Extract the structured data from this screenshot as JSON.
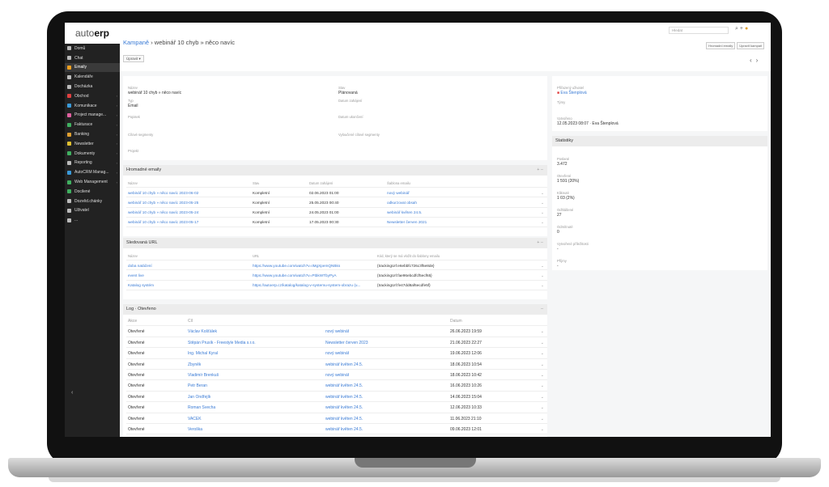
{
  "app": {
    "logo_prefix": "auto",
    "logo_suffix": "erp"
  },
  "sidebar": {
    "items": [
      {
        "label": "Domů",
        "color": "#bbbbbb",
        "icon": "home-icon"
      },
      {
        "label": "Chat",
        "color": "#bbbbbb",
        "icon": "chat-icon"
      },
      {
        "label": "Emaily",
        "color": "#f0a020",
        "icon": "mail-icon",
        "active": true
      },
      {
        "label": "Kalendáře",
        "color": "#bbbbbb",
        "icon": "calendar-icon"
      },
      {
        "label": "Docházka",
        "color": "#bbbbbb",
        "icon": "attendance-icon"
      },
      {
        "label": "Obchod",
        "color": "#e04040",
        "icon": "shop-icon",
        "chev": "›"
      },
      {
        "label": "Komunikace",
        "color": "#3a9ad9",
        "icon": "communication-icon",
        "chev": "›"
      },
      {
        "label": "Project manage...",
        "color": "#e060a0",
        "icon": "project-icon",
        "chev": "›"
      },
      {
        "label": "Fakturace",
        "color": "#40b060",
        "icon": "invoice-icon",
        "chev": "›"
      },
      {
        "label": "Banking",
        "color": "#e0a030",
        "icon": "bank-icon",
        "chev": "›"
      },
      {
        "label": "Newsletter",
        "color": "#e0c030",
        "icon": "newsletter-icon",
        "chev": "›"
      },
      {
        "label": "Dokumenty",
        "color": "#40b060",
        "icon": "documents-icon",
        "chev": "›"
      },
      {
        "label": "Reporting",
        "color": "#bbbbbb",
        "icon": "reporting-icon",
        "chev": "›"
      },
      {
        "label": "AutoCRM Manag...",
        "color": "#3a9ad9",
        "icon": "crm-icon",
        "chev": "›"
      },
      {
        "label": "Web Management",
        "color": "#40b060",
        "icon": "web-icon",
        "chev": "›"
      },
      {
        "label": "Docilené",
        "color": "#40b060",
        "icon": "target-icon"
      },
      {
        "label": "Dozvěd.chánky",
        "color": "#bbbbbb",
        "icon": "notes-icon"
      },
      {
        "label": "Uživatel",
        "color": "#bbbbbb",
        "icon": "user-icon"
      },
      {
        "label": "...",
        "color": "#bbbbbb",
        "icon": "more-icon"
      }
    ],
    "collapse": "‹"
  },
  "topbar": {
    "search_placeholder": "Hledat",
    "breadcrumb_root": "Kampaně",
    "breadcrumb_sep": "›",
    "breadcrumb_current": "webinář 10 chyb » něco navíc",
    "actions_label": "Úpravit",
    "btn1": "Hromadní emaily",
    "btn2": "Upravit kampaň",
    "prev": "‹",
    "next": "›"
  },
  "details": {
    "name_label": "Název",
    "name_value": "webinář 10 chyb » něco navíc",
    "type_label": "Typ",
    "type_value": "Email",
    "desc_label": "Popisek",
    "target_label": "Cílové segmenty",
    "product_label": "Projekt",
    "status_label": "Stav",
    "status_value": "Plánovaná",
    "start_label": "Datum zahájení",
    "end_label": "Datum ukončení",
    "excluded_label": "Vyloučené cílové segmenty"
  },
  "meta": {
    "assigned_label": "Přiřazený uživatel",
    "assigned_value": "Eva Štenplová",
    "teams_label": "Týmy",
    "created_label": "Vytvořeno",
    "created_value": "12.05.2023 08:07 · Eva Štenplová"
  },
  "stats": {
    "title": "Statistiky",
    "items": [
      {
        "label": "Poslané",
        "value": "3.472"
      },
      {
        "label": "Otevřené",
        "value": "1 591 (20%)"
      },
      {
        "label": "Kliknuté",
        "value": "1 03 (2%)"
      },
      {
        "label": "Odhlášené",
        "value": "27"
      },
      {
        "label": "Odmítnuté",
        "value": "0"
      },
      {
        "label": "Vytvořené příležitosti",
        "value": "-"
      },
      {
        "label": "Příjmy",
        "value": "-"
      }
    ]
  },
  "mass_emails": {
    "title": "Hromadné emaily",
    "tools": "+ –",
    "headers": [
      "Název",
      "Stav",
      "Datum zahájení",
      "Šablona emailu"
    ],
    "rows": [
      [
        "webinář 10 chyb » něco navíc 2023-06-02",
        "Kompletní",
        "02.06.2023 01:00",
        "nový webinář"
      ],
      [
        "webinář 10 chyb » něco navíc 2023-05-25",
        "Kompletní",
        "25.05.2023 00:40",
        "odkurzovat obsah"
      ],
      [
        "webinář 10 chyb » něco navíc 2023-05-24",
        "Kompletní",
        "24.05.2023 01:00",
        "webinář květen 24.5."
      ],
      [
        "webinář 10 chyb » něco navíc 2023-05-17",
        "Kompletní",
        "17.05.2023 00:30",
        "Newsletter červen 2021"
      ]
    ]
  },
  "tracked_urls": {
    "title": "Sledovaná URL",
    "tools": "+ –",
    "headers": [
      "Název",
      "URL",
      "Kód, který se má vložit do šablony emailu"
    ],
    "rows": [
      [
        "doba natáčení",
        "https://www.youtube.com/watch?v=tMgXpemQNBks",
        "{trackingUrl:e6ebbfc726c3f5e8de}"
      ],
      [
        "event live",
        "https://www.youtube.com/watch?v=PtbkWTbyPyA",
        "{trackingUrl:fae96ebcdfcf5ecf65}"
      ],
      [
        "Katalog systém",
        "https://autoerp.cz/katalog/katalog-v-systemu-system-obrazu (u...",
        "{trackingUrl:fe47dd8af6ecdfe5f}"
      ]
    ]
  },
  "log": {
    "title": "Log · Otevřeno",
    "tools": "–",
    "headers": [
      "Akce",
      "Cíl",
      "",
      "Datum"
    ],
    "rows": [
      [
        "Otevřené",
        "Václav Košťálek",
        "nový webinář",
        "26.06.2023 19:59"
      ],
      [
        "Otevřené",
        "Štěpán Prusík - Freestyle Media s.r.o.",
        "Newsletter červen 2023",
        "21.06.2023 22:27"
      ],
      [
        "Otevřené",
        "Ing. Michal Kyral",
        "nový webinář",
        "19.06.2023 12:06"
      ],
      [
        "Otevřené",
        "Zbyněk",
        "webinář květen 24.5.",
        "18.06.2023 10:54"
      ],
      [
        "Otevřené",
        "Vladimír Brenkuš",
        "nový webinář",
        "18.06.2023 10:42"
      ],
      [
        "Otevřené",
        "Petr Beran",
        "webinář květen 24.5.",
        "16.06.2023 10:26"
      ],
      [
        "Otevřené",
        "Jan Ondřejík",
        "webinář květen 24.5.",
        "14.06.2023 15:04"
      ],
      [
        "Otevřené",
        "Roman Švecha",
        "webinář květen 24.5.",
        "12.06.2023 10:33"
      ],
      [
        "Otevřené",
        "VACEK",
        "webinář květen 24.5.",
        "11.06.2023 21:10"
      ],
      [
        "Otevřené",
        "Veroška",
        "webinář květen 24.5.",
        "09.06.2023 12:01"
      ]
    ]
  }
}
